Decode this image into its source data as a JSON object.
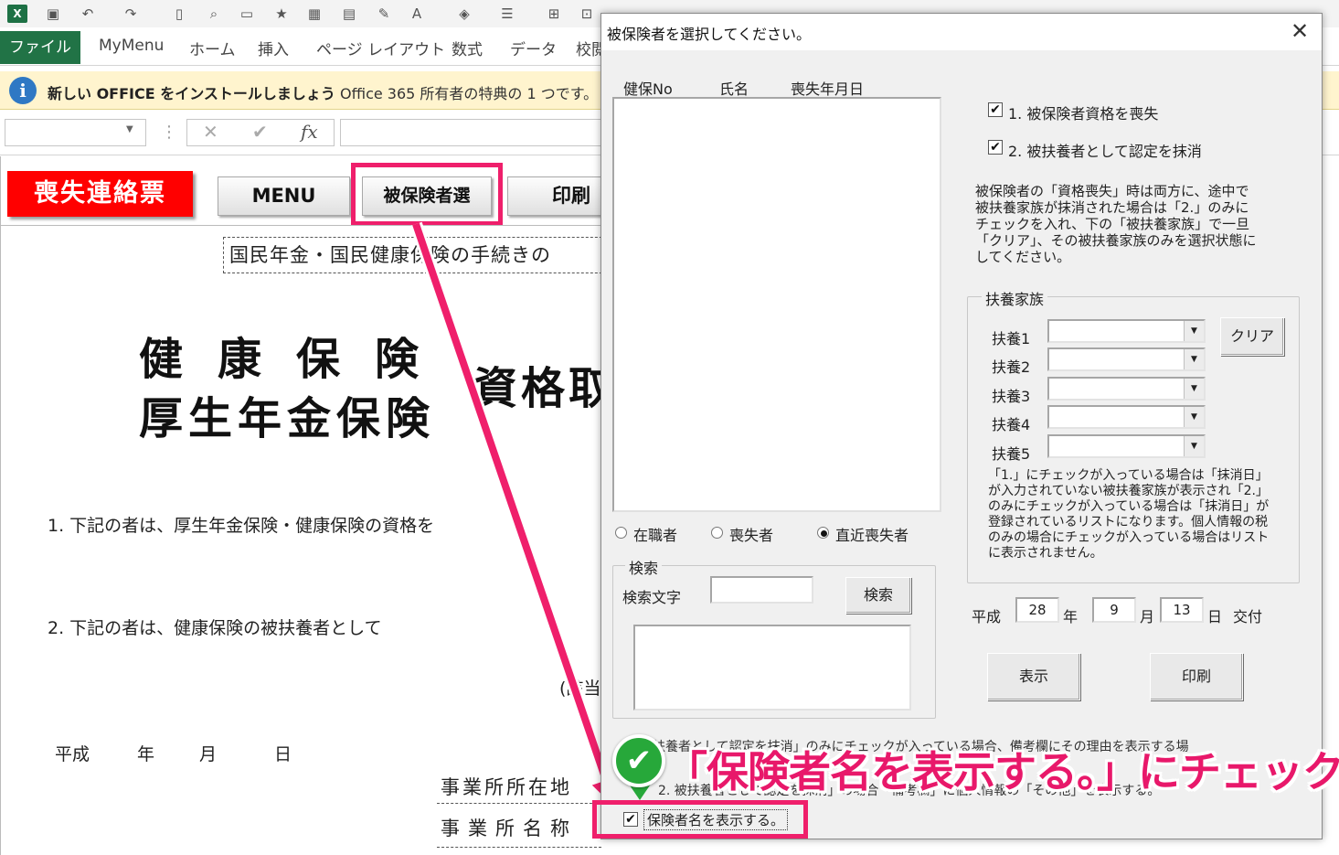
{
  "excel": {
    "logo": "X",
    "tabs": {
      "file": "ファイル",
      "items": [
        "MyMenu",
        "ホーム",
        "挿入",
        "ページ レイアウト",
        "数式",
        "データ",
        "校閲"
      ]
    },
    "infobar": {
      "bold_text": "新しい OFFICE をインストールしましょう",
      "text": "Office 365 所有者の特典の 1 つです。"
    },
    "formula_bar": {
      "cancel": "✕",
      "enter": "✔",
      "fx": "fx"
    }
  },
  "sheet": {
    "title_button": "喪失連絡票",
    "buttons": {
      "menu": "MENU",
      "insured": "被保険者選",
      "print": "印刷"
    },
    "subtitle": "国民年金・国民健康保険の手続きの",
    "title_line1": "健康保険",
    "title_line2": "厚生年金保険",
    "title_line3": "資格取",
    "line1": "1. 下記の者は、厚生年金保険・健康保険の資格を",
    "line2": "2. 下記の者は、健康保険の被扶養者として",
    "paren": "(該当",
    "date": {
      "era": "平成",
      "year": "年",
      "month": "月",
      "day": "日"
    },
    "office_address_label": "事業所所在地",
    "office_name_label": "事業所名称"
  },
  "dialog": {
    "title": "被保険者を選択してください。",
    "close": "✕",
    "list_headers": {
      "no": "健保No",
      "name": "氏名",
      "date": "喪失年月日"
    },
    "radios": [
      {
        "label": "在職者",
        "selected": false
      },
      {
        "label": "喪失者",
        "selected": false
      },
      {
        "label": "直近喪失者",
        "selected": true
      }
    ],
    "search": {
      "group_title": "検索",
      "label": "検索文字",
      "button": "検索",
      "value": ""
    },
    "checks": {
      "lost_qualification": {
        "label": "1. 被保険者資格を喪失",
        "checked": true
      },
      "remove_dependent": {
        "label": "2. 被扶養者として認定を抹消",
        "checked": true
      },
      "show_insurer_name": {
        "label": "保険者名を表示する。",
        "checked": true
      }
    },
    "explanation": "被保険者の「資格喪失」時は両方に、途中で被扶養家族が抹消された場合は「2.」のみにチェックを入れ、下の「被扶養家族」で一旦「クリア」、その被扶養家族のみを選択状態にしてください。",
    "dependents": {
      "group_title": "扶養家族",
      "labels": [
        "扶養1",
        "扶養2",
        "扶養3",
        "扶養4",
        "扶養5"
      ],
      "clear_button": "クリア",
      "note": "「1.」にチェックが入っている場合は「抹消日」が入力されていない被扶養家族が表示され「2.」のみにチェックが入っている場合は「抹消日」が登録されているリストになります。個人情報の税のみの場合にチェックが入っている場合はリストに表示されません。"
    },
    "issue_date": {
      "era": "平成",
      "year": "28",
      "year_label": "年",
      "month": "9",
      "month_label": "月",
      "day": "13",
      "day_label": "日",
      "suffix": "交付"
    },
    "buttons": {
      "show": "表示",
      "print": "印刷"
    },
    "bottom_note_1": "被扶養者として認定を抹消」のみにチェックが入っている場合、備考欄にその理由を表示する場",
    "bottom_note_2": "2. 被扶養者として認定を抹消」の場合「備考欄」に個人情報の「その他」を表示する。"
  },
  "annotation": {
    "callout": "「保険者名を表示する。」にチェック",
    "check_icon": "✔"
  }
}
